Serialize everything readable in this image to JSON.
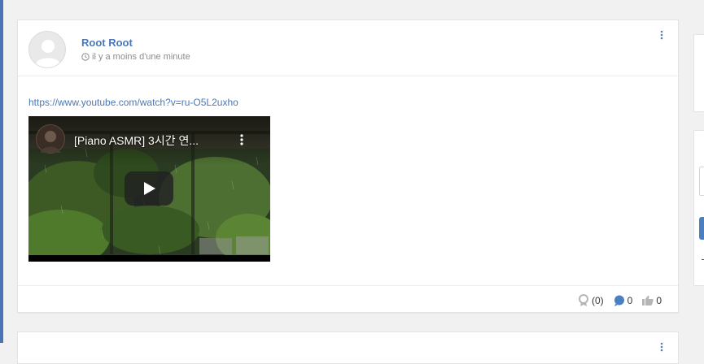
{
  "post": {
    "author": "Root Root",
    "time": "il y a moins d'une minute",
    "link": "https://www.youtube.com/watch?v=ru-O5L2uxho",
    "video": {
      "title": "[Piano ASMR] 3시간 연..."
    },
    "footer": {
      "awards": "(0)",
      "comments": "0",
      "likes": "0"
    }
  },
  "icons": {
    "clock": "clock-icon",
    "more": "more-vertical-icon",
    "play": "play-icon",
    "award": "award-icon",
    "comment": "comment-icon",
    "like": "thumbs-up-icon"
  },
  "colors": {
    "accent": "#4a74b4",
    "link": "#4b78b5",
    "background": "#f1f1f1"
  }
}
